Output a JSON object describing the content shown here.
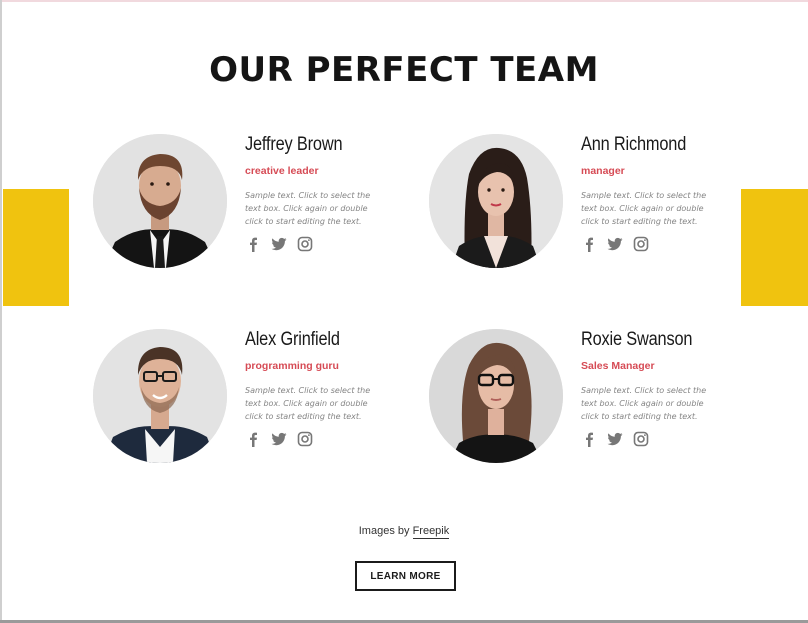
{
  "section": {
    "title": "OUR PERFECT TEAM",
    "accent_color": "#f0c30f"
  },
  "team": [
    {
      "name": "Jeffrey Brown",
      "role": "creative leader",
      "description": "Sample text. Click to select the text box. Click again or double click to start editing the text.",
      "social": [
        "facebook-icon",
        "twitter-icon",
        "instagram-icon"
      ]
    },
    {
      "name": "Ann Richmond",
      "role": "manager",
      "description": "Sample text. Click to select the text box. Click again or double click to start editing the text.",
      "social": [
        "facebook-icon",
        "twitter-icon",
        "instagram-icon"
      ]
    },
    {
      "name": "Alex Grinfield",
      "role": "programming guru",
      "description": "Sample text. Click to select the text box. Click again or double click to start editing the text.",
      "social": [
        "facebook-icon",
        "twitter-icon",
        "instagram-icon"
      ]
    },
    {
      "name": "Roxie Swanson",
      "role": "Sales Manager",
      "description": "Sample text. Click to select the text box. Click again or double click to start editing the text.",
      "social": [
        "facebook-icon",
        "twitter-icon",
        "instagram-icon"
      ]
    }
  ],
  "credit": {
    "prefix": "Images by",
    "link": "Freepik"
  },
  "cta": {
    "label": "LEARN MORE"
  },
  "colors": {
    "role": "#d64b55",
    "icon": "#777777",
    "text": "#1a1a1a"
  }
}
